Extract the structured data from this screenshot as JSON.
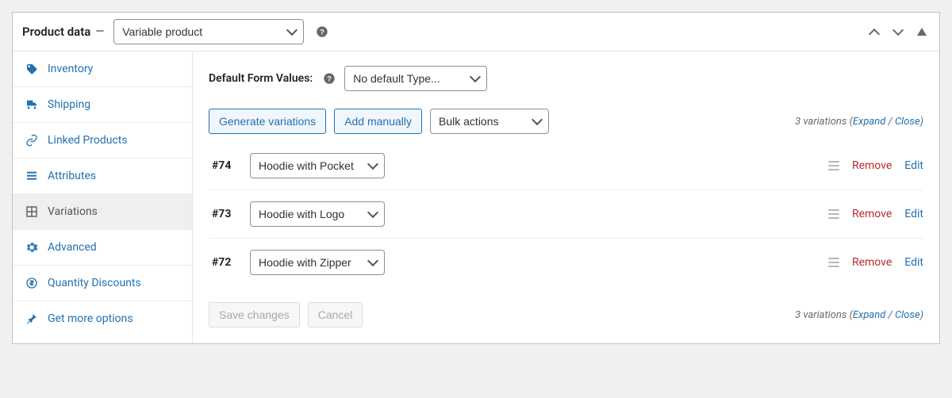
{
  "header": {
    "label": "Product data",
    "dash": "—",
    "product_type": "Variable product"
  },
  "sidebar": {
    "items": [
      {
        "label": "Inventory"
      },
      {
        "label": "Shipping"
      },
      {
        "label": "Linked Products"
      },
      {
        "label": "Attributes"
      },
      {
        "label": "Variations"
      },
      {
        "label": "Advanced"
      },
      {
        "label": "Quantity Discounts"
      },
      {
        "label": "Get more options"
      }
    ]
  },
  "content": {
    "default_form_label": "Default Form Values:",
    "default_form_select": "No default Type...",
    "btn_generate": "Generate variations",
    "btn_add_manually": "Add manually",
    "bulk_actions": "Bulk actions",
    "status_prefix": "3 variations (",
    "status_expand": "Expand",
    "status_sep": " / ",
    "status_close": "Close",
    "status_suffix": ")",
    "btn_save": "Save changes",
    "btn_cancel": "Cancel"
  },
  "variations": [
    {
      "id": "#74",
      "option": "Hoodie with Pocket",
      "remove": "Remove",
      "edit": "Edit"
    },
    {
      "id": "#73",
      "option": "Hoodie with Logo",
      "remove": "Remove",
      "edit": "Edit"
    },
    {
      "id": "#72",
      "option": "Hoodie with Zipper",
      "remove": "Remove",
      "edit": "Edit"
    }
  ]
}
